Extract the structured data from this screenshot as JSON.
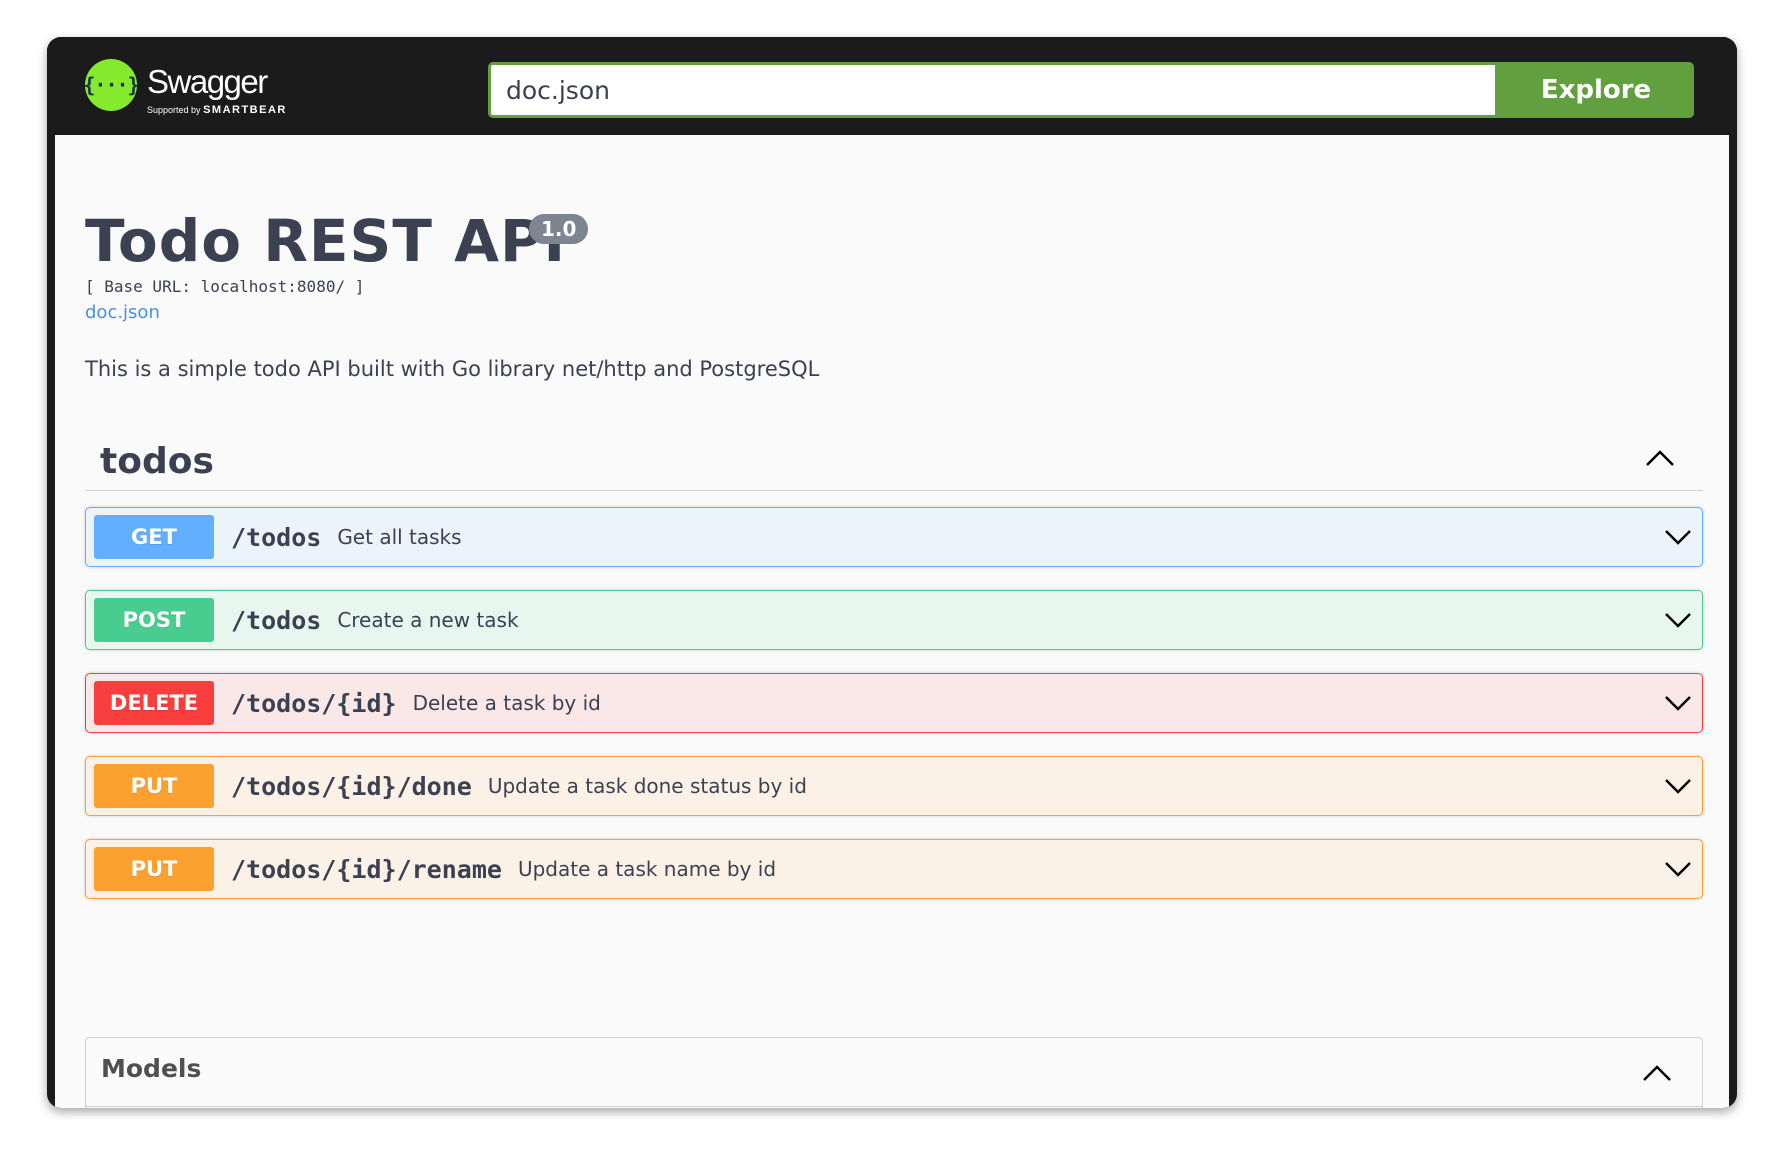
{
  "topbar": {
    "logo": {
      "mark": "{···}",
      "wordmark": "Swagger",
      "supported_by": "Supported by",
      "brand": "SMARTBEAR"
    },
    "search": {
      "value": "doc.json"
    },
    "explore_label": "Explore"
  },
  "info": {
    "title": "Todo REST API",
    "version": "1.0",
    "base_url": "[ Base URL: localhost:8080/ ]",
    "spec_link": "doc.json",
    "description": "This is a simple todo API built with Go library net/http and PostgreSQL"
  },
  "tag": {
    "name": "todos",
    "operations": [
      {
        "method": "GET",
        "path": "/todos",
        "summary": "Get all tasks"
      },
      {
        "method": "POST",
        "path": "/todos",
        "summary": "Create a new task"
      },
      {
        "method": "DELETE",
        "path": "/todos/{id}",
        "summary": "Delete a task by id"
      },
      {
        "method": "PUT",
        "path": "/todos/{id}/done",
        "summary": "Update a task done status by id"
      },
      {
        "method": "PUT",
        "path": "/todos/{id}/rename",
        "summary": "Update a task name by id"
      }
    ]
  },
  "models": {
    "title": "Models"
  },
  "colors": {
    "get": "#61affe",
    "post": "#49cc90",
    "delete": "#f93e3e",
    "put": "#fca130",
    "explore": "#62a03f",
    "logo": "#85ea2d"
  },
  "icons": {
    "collapse": "chevron-up-icon",
    "expand": "chevron-down-icon"
  }
}
